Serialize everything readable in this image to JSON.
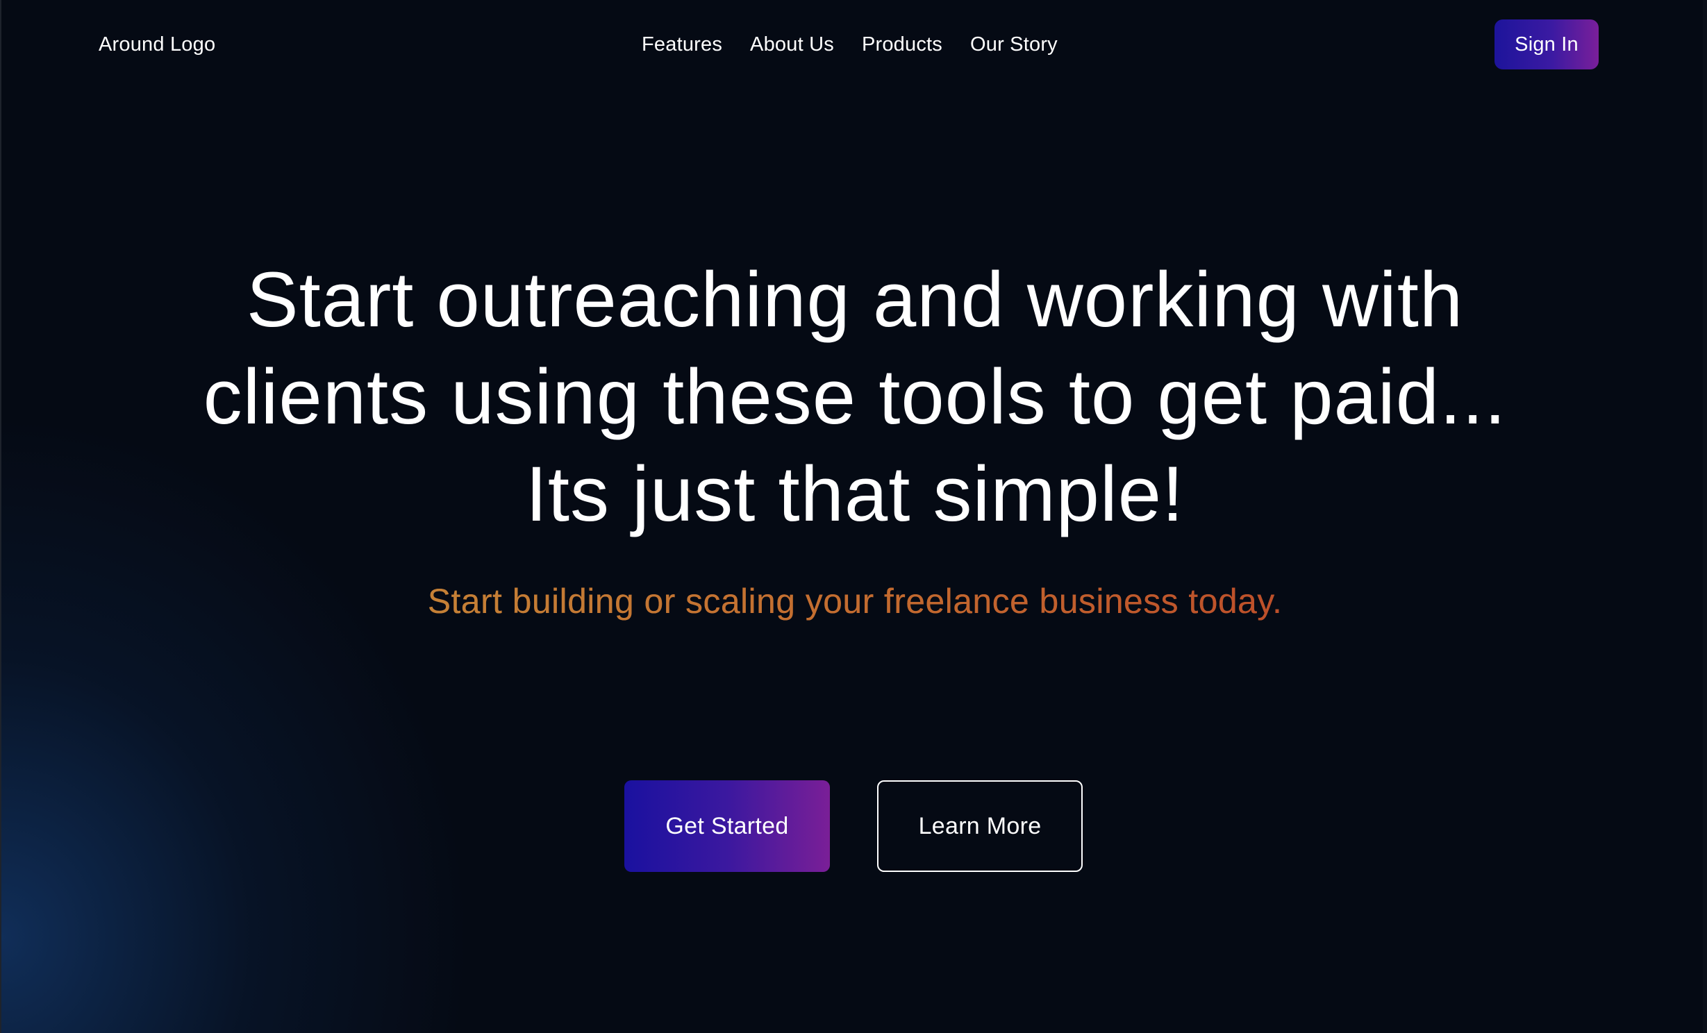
{
  "header": {
    "logo": "Around Logo",
    "nav": [
      "Features",
      "About Us",
      "Products",
      "Our Story"
    ],
    "signin_label": "Sign In"
  },
  "hero": {
    "title_lines": [
      "Start outreaching and working with",
      "clients using these tools to get paid...",
      "Its just that simple!"
    ],
    "subtitle": "Start building or scaling your freelance business today.",
    "primary_cta": "Get Started",
    "secondary_cta": "Learn More"
  },
  "colors": {
    "background": "#050a14",
    "text": "#ffffff",
    "subtitle_gradient": [
      "#c58136",
      "#bd4f2a"
    ],
    "button_gradient": [
      "#1a119f",
      "#7a1f97"
    ]
  }
}
